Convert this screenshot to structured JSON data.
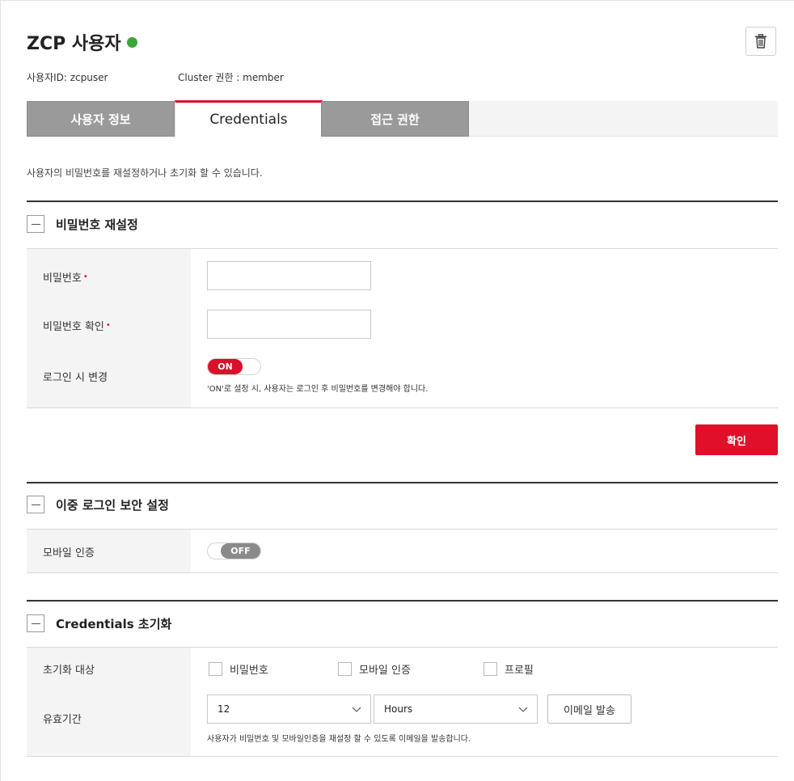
{
  "header": {
    "title": "ZCP 사용자",
    "status_color": "#3aa53a",
    "delete_icon": "trash-icon",
    "user_id": "사용자ID: zcpuser",
    "cluster_role": "Cluster 권한 : member"
  },
  "tabs": [
    {
      "label": "사용자 정보",
      "active": false
    },
    {
      "label": "Credentials",
      "active": true
    },
    {
      "label": "접근 권한",
      "active": false
    }
  ],
  "description": "사용자의 비밀번호를 재설정하거나 초기화 할 수 있습니다.",
  "password_reset": {
    "title": "비밀번호 재설정",
    "password_label": "비밀번호",
    "password_confirm_label": "비밀번호 확인",
    "required_mark": "•",
    "change_on_login_label": "로그인 시 변경",
    "toggle_state": "ON",
    "toggle_hint": "'ON'로 설정 시, 사용자는 로그인 후 비밀번호를 변경해야 합니다.",
    "confirm_label": "확인"
  },
  "two_factor": {
    "title": "이중 로그인 보안 설정",
    "mobile_auth_label": "모바일 인증",
    "toggle_state": "OFF"
  },
  "credentials_reset": {
    "title": "Credentials 초기화",
    "target_label": "초기화 대상",
    "targets": [
      "비밀번호",
      "모바일 인증",
      "프로필"
    ],
    "validity_label": "유효기간",
    "validity_value": "12",
    "validity_unit": "Hours",
    "email_button": "이메일 발송",
    "hint": "사용자가 비밀번호 및 모바일인증을 재설정 할 수 있도록 이메일을 발송합니다."
  },
  "colors": {
    "accent": "#d9102a",
    "tab_inactive": "#9a9a9a",
    "status_online": "#3aa53a"
  }
}
